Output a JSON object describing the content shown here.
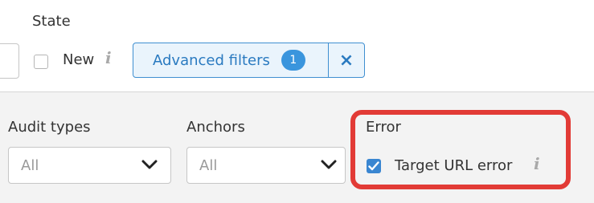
{
  "state": {
    "label": "State",
    "new_label": "New",
    "new_checked": false
  },
  "advanced_filters": {
    "label": "Advanced filters",
    "count": "1",
    "clear_symbol": "×"
  },
  "filters": {
    "audit_types": {
      "label": "Audit types",
      "value": "All"
    },
    "anchors": {
      "label": "Anchors",
      "value": "All"
    }
  },
  "error": {
    "label": "Error",
    "item_label": "Target URL error",
    "item_checked": true
  },
  "icons": {
    "info": "info-icon",
    "chevron": "chevron-down-icon",
    "check": "check-icon",
    "close": "close-icon"
  },
  "colors": {
    "accent": "#3a86d1",
    "highlight_border": "#e23b36",
    "filter_bg": "#f3f3f3"
  }
}
